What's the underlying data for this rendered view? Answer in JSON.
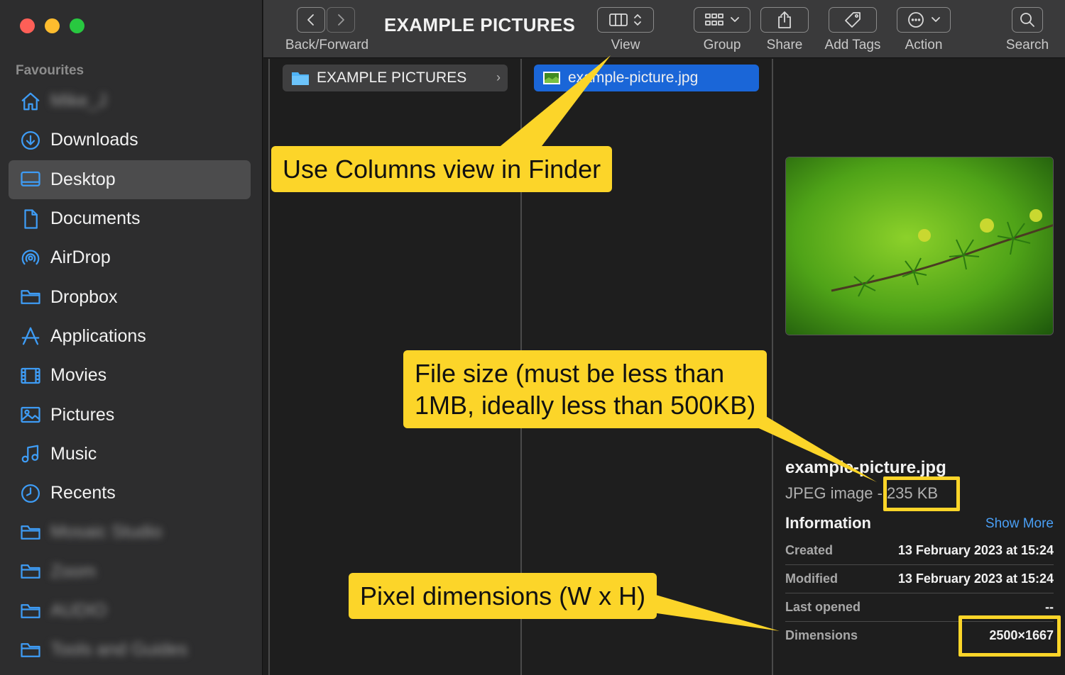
{
  "sidebar": {
    "heading": "Favourites",
    "items": [
      {
        "label": "Mike_J",
        "icon": "home-icon",
        "blurred": true
      },
      {
        "label": "Downloads",
        "icon": "download-icon"
      },
      {
        "label": "Desktop",
        "icon": "desktop-icon",
        "selected": true
      },
      {
        "label": "Documents",
        "icon": "document-icon"
      },
      {
        "label": "AirDrop",
        "icon": "airdrop-icon"
      },
      {
        "label": "Dropbox",
        "icon": "folder-icon"
      },
      {
        "label": "Applications",
        "icon": "applications-icon"
      },
      {
        "label": "Movies",
        "icon": "film-icon"
      },
      {
        "label": "Pictures",
        "icon": "picture-icon"
      },
      {
        "label": "Music",
        "icon": "music-icon"
      },
      {
        "label": "Recents",
        "icon": "clock-icon"
      },
      {
        "label": "Mosaic Studio",
        "icon": "folder-icon",
        "blurred": true
      },
      {
        "label": "Zoom",
        "icon": "folder-icon",
        "blurred": true
      },
      {
        "label": "AUDIO",
        "icon": "folder-icon",
        "blurred": true
      },
      {
        "label": "Tools and Guides",
        "icon": "folder-icon",
        "blurred": true
      }
    ]
  },
  "toolbar": {
    "title": "EXAMPLE PICTURES",
    "back_forward_label": "Back/Forward",
    "view_label": "View",
    "group_label": "Group",
    "share_label": "Share",
    "add_tags_label": "Add Tags",
    "action_label": "Action",
    "search_label": "Search"
  },
  "columns": {
    "folder_name": "EXAMPLE PICTURES",
    "file_name": "example-picture.jpg"
  },
  "preview": {
    "file_name": "example-picture.jpg",
    "kind": "JPEG image -",
    "size": "235 KB",
    "info_heading": "Information",
    "show_more": "Show More",
    "rows": [
      {
        "key": "Created",
        "value": "13 February 2023 at 15:24"
      },
      {
        "key": "Modified",
        "value": "13 February 2023 at 15:24"
      },
      {
        "key": "Last opened",
        "value": "--"
      },
      {
        "key": "Dimensions",
        "value": "2500×1667"
      }
    ]
  },
  "annotations": {
    "columns_view": "Use Columns view in Finder",
    "file_size_line1": "File size (must be less than",
    "file_size_line2": "1MB, ideally less than 500KB)",
    "pixel_dimensions": "Pixel dimensions (W x H)"
  },
  "colors": {
    "accent": "#1a66d8",
    "callout": "#fcd529",
    "sidebar_icon": "#3e9cf5"
  }
}
